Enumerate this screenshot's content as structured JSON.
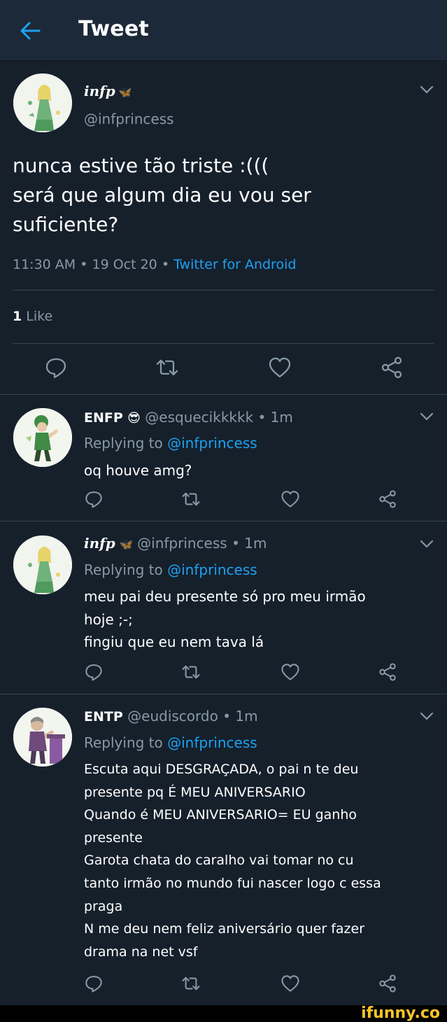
{
  "header": {
    "title": "Tweet"
  },
  "main_tweet": {
    "name": "infp",
    "name_emoji": "🦋",
    "handle": "@infprincess",
    "text_lines": [
      "nunca estive tão triste :(((",
      "será que algum dia eu vou ser",
      "suficiente?"
    ],
    "time": "11:30 AM",
    "date": "19 Oct 20",
    "source": "Twitter for Android",
    "likes_count": "1",
    "likes_label": "Like"
  },
  "replies": [
    {
      "name": "ENFP",
      "name_emoji": "😎",
      "handle": "@esquecikkkkk",
      "time": "1m",
      "replying_label": "Replying to",
      "replying_handle": "@infprincess",
      "lines": [
        "oq houve amg?"
      ]
    },
    {
      "name": "infp",
      "name_emoji": "🦋",
      "handle": "@infprincess",
      "time": "1m",
      "replying_label": "Replying to",
      "replying_handle": "@infprincess",
      "lines": [
        "meu pai deu presente só pro meu irmão",
        "hoje ;-;",
        "fingiu que eu nem tava lá"
      ]
    },
    {
      "name": "ENTP",
      "name_emoji": "",
      "handle": "@eudiscordo",
      "time": "1m",
      "replying_label": "Replying to",
      "replying_handle": "@infprincess",
      "lines": [
        "Escuta aqui DESGRAÇADA, o pai n te deu",
        "presente pq É MEU ANIVERSARIO",
        "Quando é MEU ANIVERSARIO= EU ganho",
        "presente",
        "Garota chata do caralho vai tomar no cu",
        "tanto irmão no mundo fui nascer logo c essa",
        "praga",
        "N me deu nem feliz aniversário  quer fazer",
        "drama na net vsf"
      ]
    }
  ],
  "watermark": "ifunny.co",
  "colors": {
    "background": "#15202b",
    "header": "#1c2938",
    "accent": "#1da1f2",
    "muted": "#8899a6",
    "divider": "#38444d"
  }
}
